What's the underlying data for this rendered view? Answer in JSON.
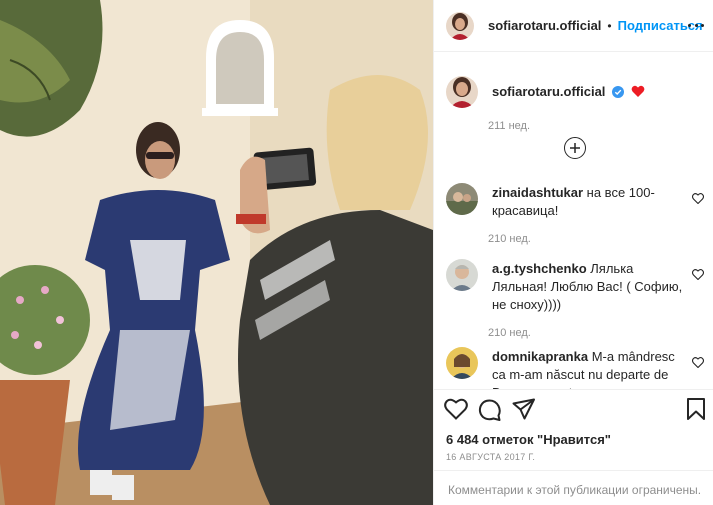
{
  "post": {
    "author": "sofiarotaru.official",
    "follow_label": "Подписаться",
    "header_separator": "•"
  },
  "caption": {
    "username": "sofiarotaru.official",
    "time": "211 нед."
  },
  "comments": [
    {
      "username": "zinaidashtukar",
      "text": "на все 100-красавица!",
      "time": "210 нед."
    },
    {
      "username": "a.g.tyshchenko",
      "text": "Лялька Ляльная! Люблю Вас! ( Софию, не сноху))))",
      "time": "210 нед."
    },
    {
      "username": "domnikapranka",
      "text": "M-a mândresc ca m-am născut nu departe de Dumneavoastra",
      "time": ""
    }
  ],
  "stats": {
    "likes": "6 484 отметок \"Нравится\"",
    "date": "16 АВГУСТА 2017 Г."
  },
  "footer": {
    "comments_limited": "Комментарии к этой публикации ограничены."
  },
  "icons": [
    "more-icon",
    "verified-icon",
    "heart-emoji-icon",
    "load-more-icon",
    "like-icon",
    "comment-icon",
    "share-icon",
    "bookmark-icon"
  ],
  "colors": {
    "link_blue": "#0095f6",
    "text": "#262626",
    "secondary": "#8e8e8e",
    "verified": "#3897f0",
    "heart": "#ed4956"
  }
}
